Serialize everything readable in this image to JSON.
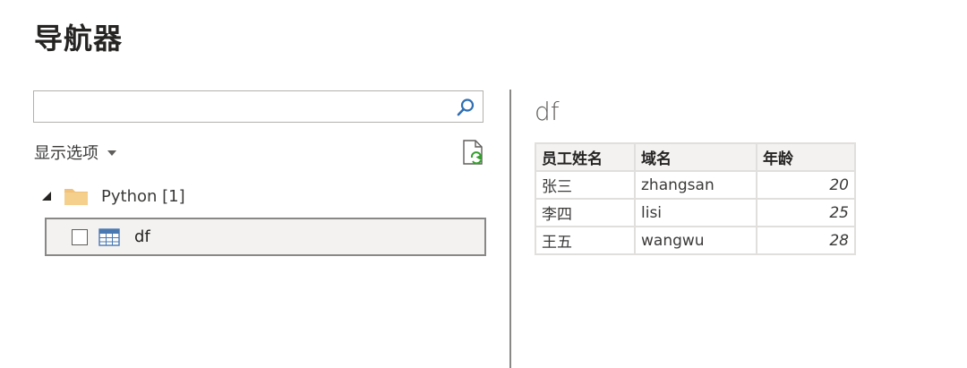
{
  "title": "导航器",
  "search": {
    "value": "",
    "placeholder": ""
  },
  "display_options_label": "显示选项",
  "tree": {
    "folder_label": "Python [1]",
    "items": [
      {
        "label": "df",
        "checked": false
      }
    ]
  },
  "preview": {
    "title": "df",
    "columns": [
      "员工姓名",
      "域名",
      "年龄"
    ],
    "rows": [
      [
        "张三",
        "zhangsan",
        "20"
      ],
      [
        "李四",
        "lisi",
        "25"
      ],
      [
        "王五",
        "wangwu",
        "28"
      ]
    ]
  },
  "icons": {
    "search": "search-icon",
    "refresh": "refresh-icon",
    "folder": "folder-icon",
    "table": "table-icon"
  },
  "colors": {
    "accent": "#2f6fb3",
    "folder": "#f0c27a",
    "refresh": "#33a02c",
    "border": "#8a8886"
  }
}
